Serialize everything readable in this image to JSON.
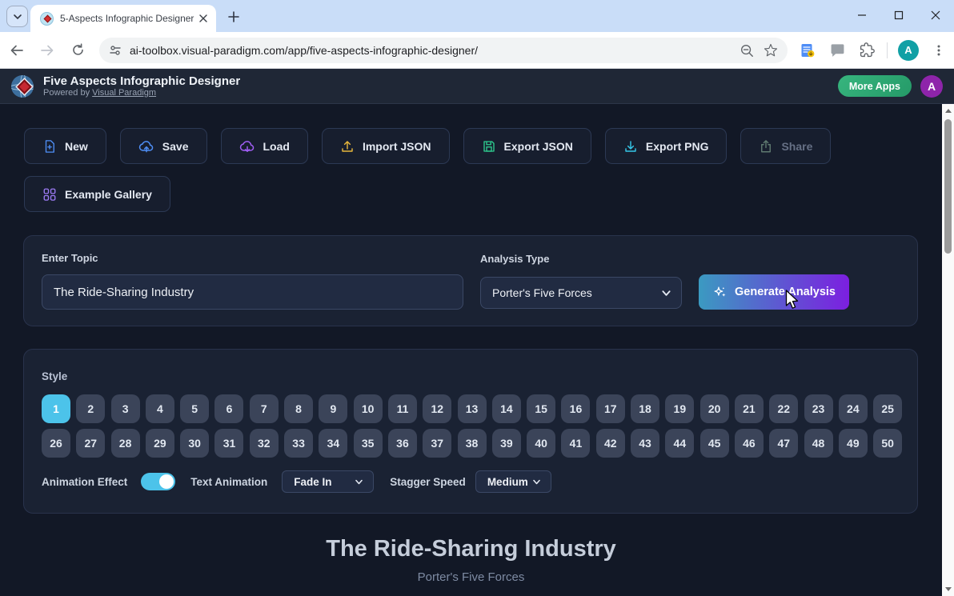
{
  "browser": {
    "tab_title": "5-Aspects Infographic Designer",
    "url": "ai-toolbox.visual-paradigm.com/app/five-aspects-infographic-designer/",
    "avatar_letter": "A"
  },
  "header": {
    "title": "Five Aspects Infographic Designer",
    "powered_prefix": "Powered by ",
    "powered_link": "Visual Paradigm",
    "more_apps_label": "More Apps",
    "avatar_letter": "A"
  },
  "toolbar": {
    "new_label": "New",
    "save_label": "Save",
    "load_label": "Load",
    "import_json_label": "Import JSON",
    "export_json_label": "Export JSON",
    "export_png_label": "Export PNG",
    "share_label": "Share",
    "example_gallery_label": "Example Gallery"
  },
  "form": {
    "topic_label": "Enter Topic",
    "topic_value": "The Ride-Sharing Industry",
    "analysis_label": "Analysis Type",
    "analysis_value": "Porter's Five Forces",
    "generate_label": "Generate Analysis"
  },
  "style_section": {
    "label": "Style",
    "count": 50,
    "selected": 1,
    "animation_effect_label": "Animation Effect",
    "animation_on": true,
    "text_animation_label": "Text Animation",
    "text_animation_value": "Fade In",
    "stagger_speed_label": "Stagger Speed",
    "stagger_speed_value": "Medium"
  },
  "preview": {
    "title": "The Ride-Sharing Industry",
    "subtitle": "Porter's Five Forces"
  },
  "colors": {
    "accent_cyan": "#4cc3ea",
    "generate_gradient_start": "#3b9ac1",
    "generate_gradient_end": "#7c1fe0",
    "more_apps_green": "#37b57e",
    "header_avatar_purple": "#8e24aa",
    "browser_avatar_teal": "#11a0a5",
    "page_background": "#121826",
    "card_background": "#1a2233"
  }
}
